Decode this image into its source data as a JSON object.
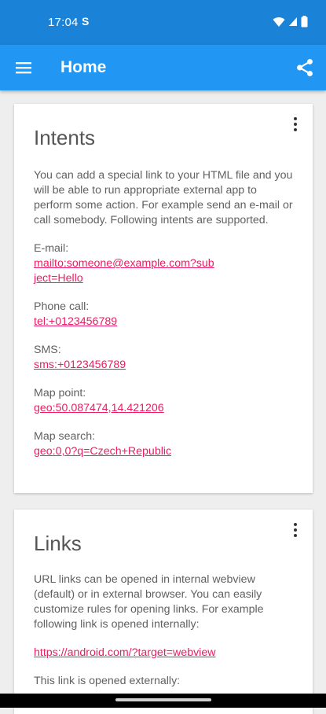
{
  "status": {
    "time": "17:04",
    "sim_icon_text": "S"
  },
  "appbar": {
    "title": "Home",
    "menu_icon": "hamburger-menu-icon",
    "share_icon": "share-icon"
  },
  "intents_card": {
    "title": "Intents",
    "description": "You can add a special link to your HTML file and you will be able to run appropriate external app to perform some action. For example send an e-mail or call somebody. Following intents are supported.",
    "items": [
      {
        "label": "E-mail:",
        "link": "mailto:someone@example.com?subject=Hello"
      },
      {
        "label": "Phone call:",
        "link": "tel:+0123456789"
      },
      {
        "label": "SMS:",
        "link": "sms:+0123456789"
      },
      {
        "label": "Map point:",
        "link": "geo:50.087474,14.421206"
      },
      {
        "label": "Map search:",
        "link": "geo:0,0?q=Czech+Republic"
      }
    ]
  },
  "links_card": {
    "title": "Links",
    "description": "URL links can be opened in internal webview (default) or in external browser. You can easily customize rules for opening links. For example following link is opened internally:",
    "link_internal": "https://android.com/?target=webview",
    "external_text": "This link is opened externally:"
  },
  "colors": {
    "statusbar": "#1a82d7",
    "appbar": "#2196f3",
    "link": "#e91e63",
    "background": "#eeeeee"
  }
}
